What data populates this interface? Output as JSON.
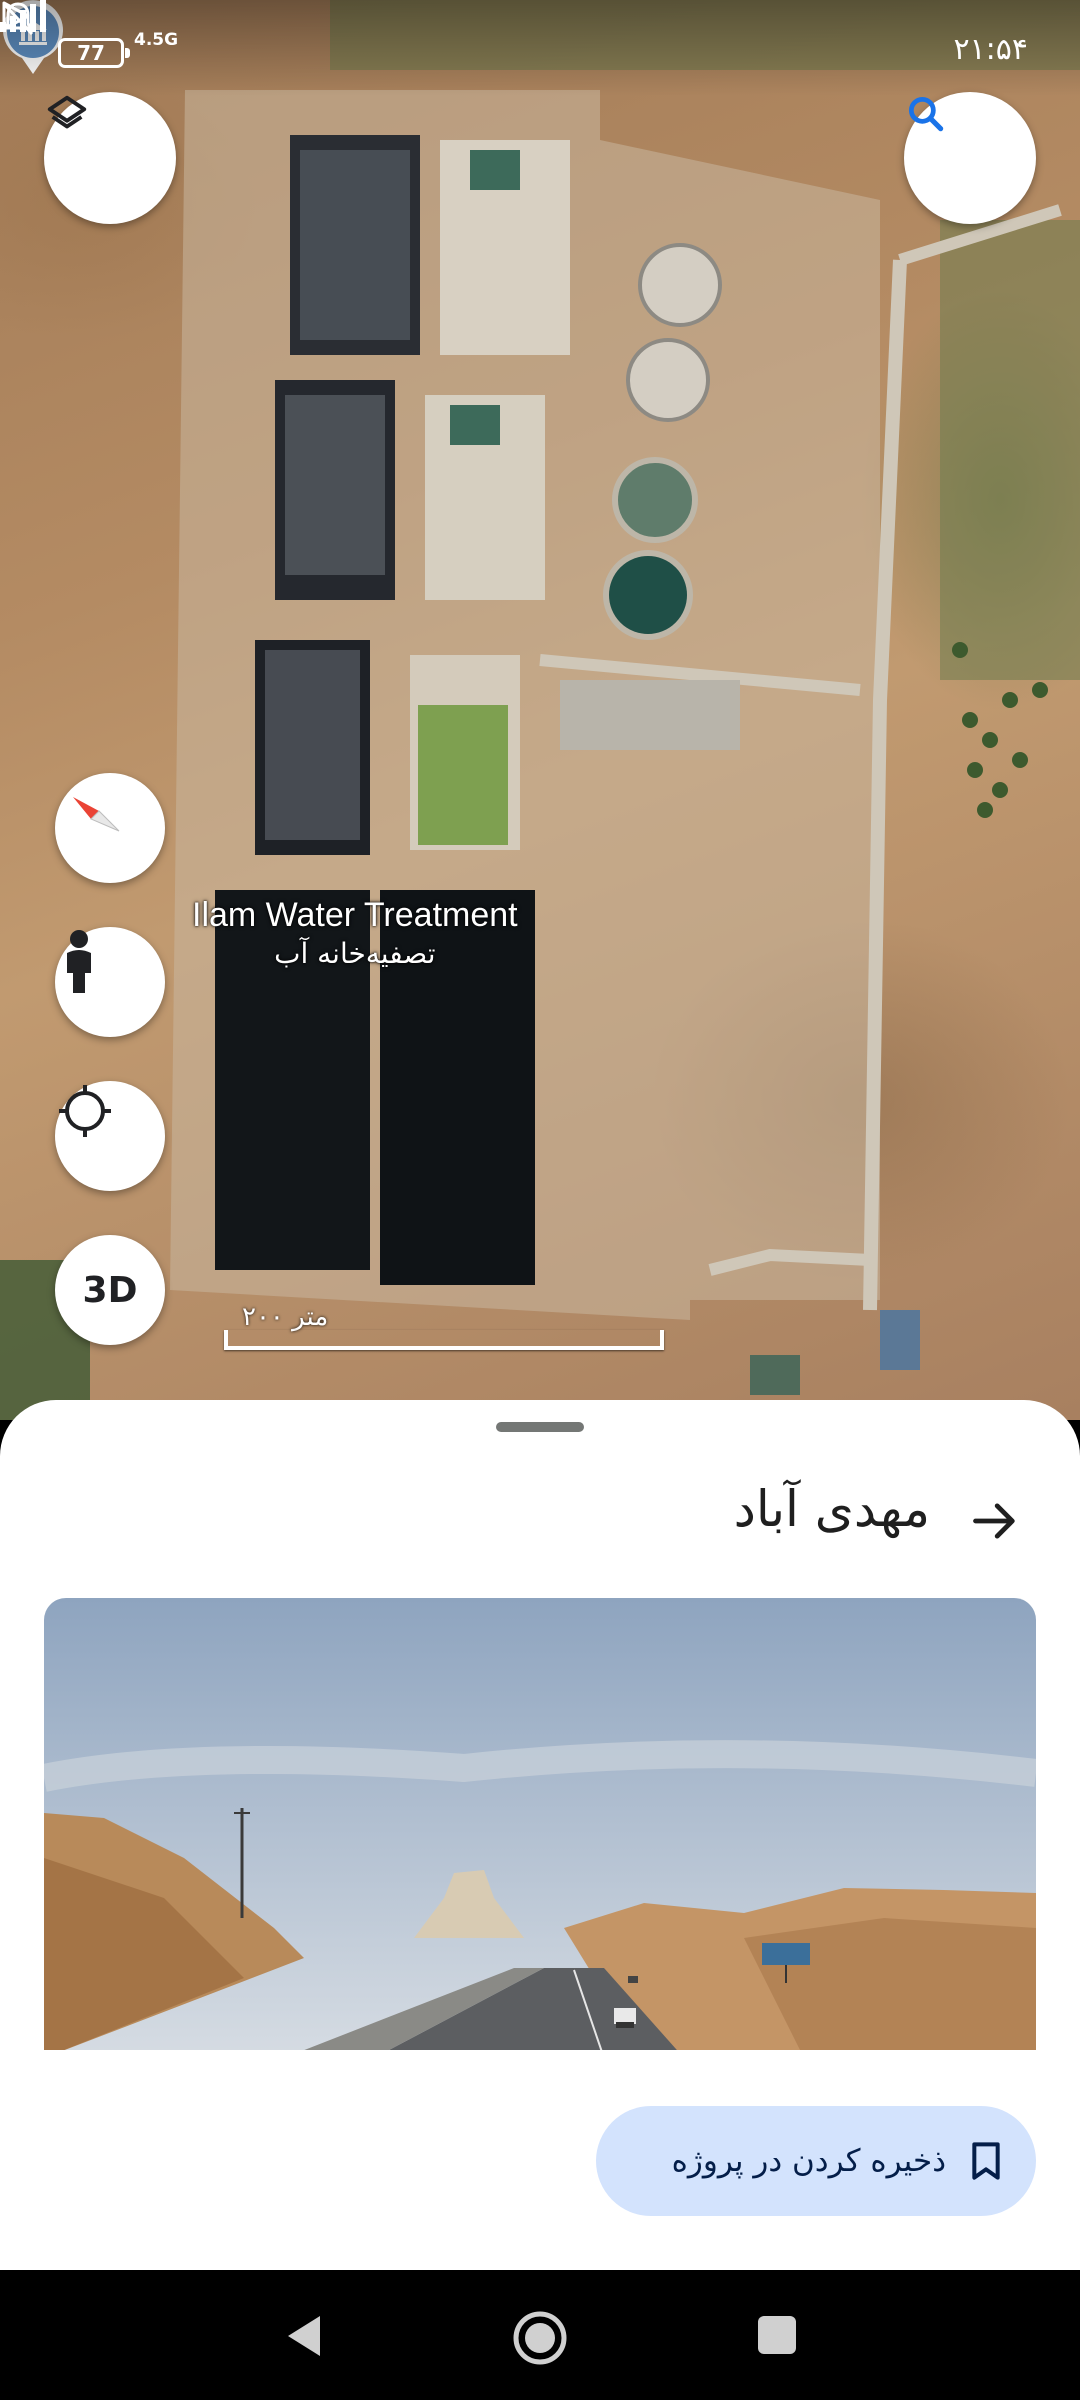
{
  "status_bar": {
    "battery": "77",
    "network": "4.5G",
    "time": "۲۱:۵۴"
  },
  "map": {
    "place_name_en": "Ilam Water Treatment",
    "place_name_fa": "تصفیه‌خانه آب",
    "scale_label": "۲۰۰ متر",
    "buttons": {
      "layers_icon": "layers-icon",
      "search_icon": "search-icon",
      "compass_icon": "compass-icon",
      "street_view_icon": "pegman-icon",
      "my_location_icon": "my-location-icon",
      "three_d_label": "3D"
    },
    "accent_color": "#1a73e8"
  },
  "sheet": {
    "title": "مهدی آباد",
    "save_button_label": "ذخیره کردن در پروژه"
  },
  "nav_bar": {
    "back_icon": "back-triangle-icon",
    "home_icon": "home-circle-icon",
    "recent_icon": "recents-square-icon"
  }
}
